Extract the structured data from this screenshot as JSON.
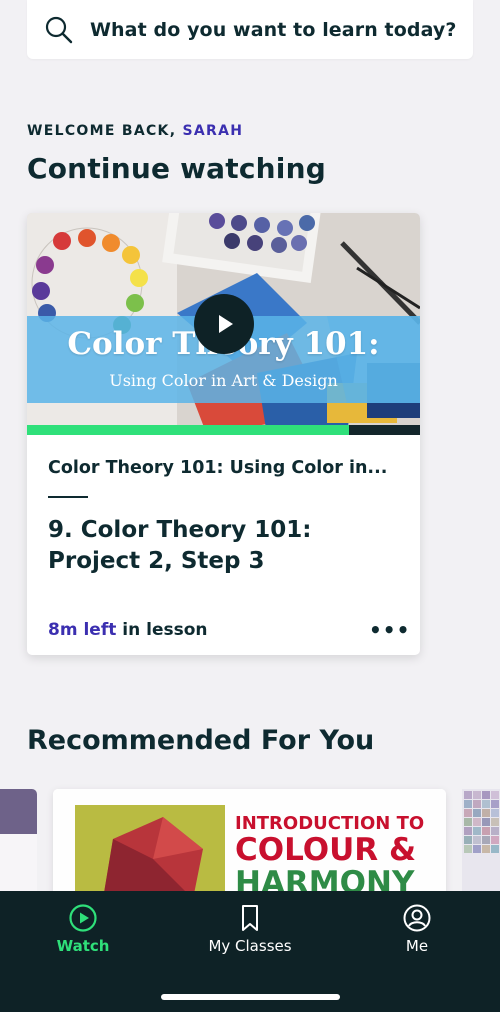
{
  "search": {
    "placeholder": "What do you want to learn today?"
  },
  "welcome": {
    "prefix": "WELCOME BACK,",
    "name": "SARAH"
  },
  "continue_watching": {
    "heading": "Continue watching",
    "thumbnail": {
      "title": "Color Theory 101:",
      "subtitle": "Using Color in Art & Design"
    },
    "progress_fraction": 0.82,
    "class_name": "Color Theory 101: Using Color in...",
    "lesson_title": "9. Color Theory 101: Project 2, Step 3",
    "time_left": "8m left",
    "time_suffix": "in lesson"
  },
  "recommended": {
    "heading": "Recommended For You",
    "card": {
      "line1": "INTRODUCTION TO",
      "line2": "COLOUR &",
      "line3": "HARMONY"
    }
  },
  "nav": {
    "items": [
      {
        "label": "Watch",
        "icon": "play-circle-icon",
        "active": true
      },
      {
        "label": "My Classes",
        "icon": "bookmark-icon",
        "active": false
      },
      {
        "label": "Me",
        "icon": "user-icon",
        "active": false
      }
    ]
  },
  "colors": {
    "background": "#f2f1f4",
    "text": "#0e2a30",
    "accent_purple": "#3b2fb0",
    "accent_green": "#2fe07a",
    "nav_bg": "#0e2226"
  }
}
